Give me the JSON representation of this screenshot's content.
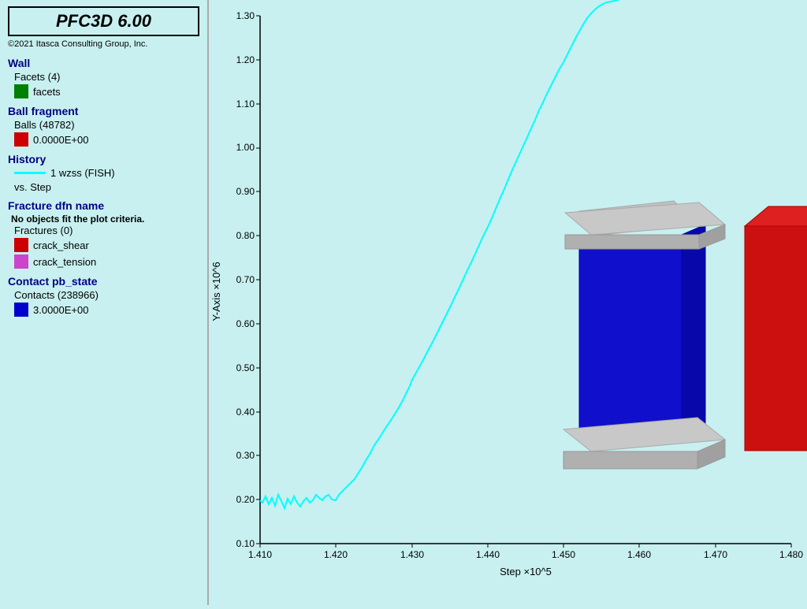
{
  "app": {
    "title": "PFC3D 6.00",
    "copyright": "©2021 Itasca Consulting Group, Inc."
  },
  "legend": {
    "wall_header": "Wall",
    "facets_sub": "Facets (4)",
    "facets_label": "facets",
    "facets_color": "#008000",
    "ball_fragment_header": "Ball fragment",
    "balls_sub": "Balls (48782)",
    "balls_value": "0.0000E+00",
    "balls_color": "#cc0000",
    "history_header": "History",
    "history_line_label": "1 wzss (FISH)",
    "history_vs": "vs. Step",
    "fracture_header": "Fracture dfn name",
    "no_objects": "No objects fit the plot criteria.",
    "fractures_sub": "Fractures (0)",
    "crack_shear_label": "crack_shear",
    "crack_shear_color": "#cc0000",
    "crack_tension_label": "crack_tension",
    "crack_tension_color": "#cc44cc",
    "contact_header": "Contact pb_state",
    "contacts_sub": "Contacts (238966)",
    "contacts_value": "3.0000E+00",
    "contacts_color": "#0000cc"
  },
  "chart": {
    "y_axis_label": "Y-Axis ×10^6",
    "x_axis_label": "Step ×10^5",
    "y_ticks": [
      "0.10",
      "0.20",
      "0.30",
      "0.40",
      "0.50",
      "0.60",
      "0.70",
      "0.80",
      "0.90",
      "1.00",
      "1.10",
      "1.20",
      "1.30"
    ],
    "x_ticks": [
      "1.410",
      "1.420",
      "1.430",
      "1.440",
      "1.450",
      "1.460",
      "1.470",
      "1.480"
    ]
  }
}
